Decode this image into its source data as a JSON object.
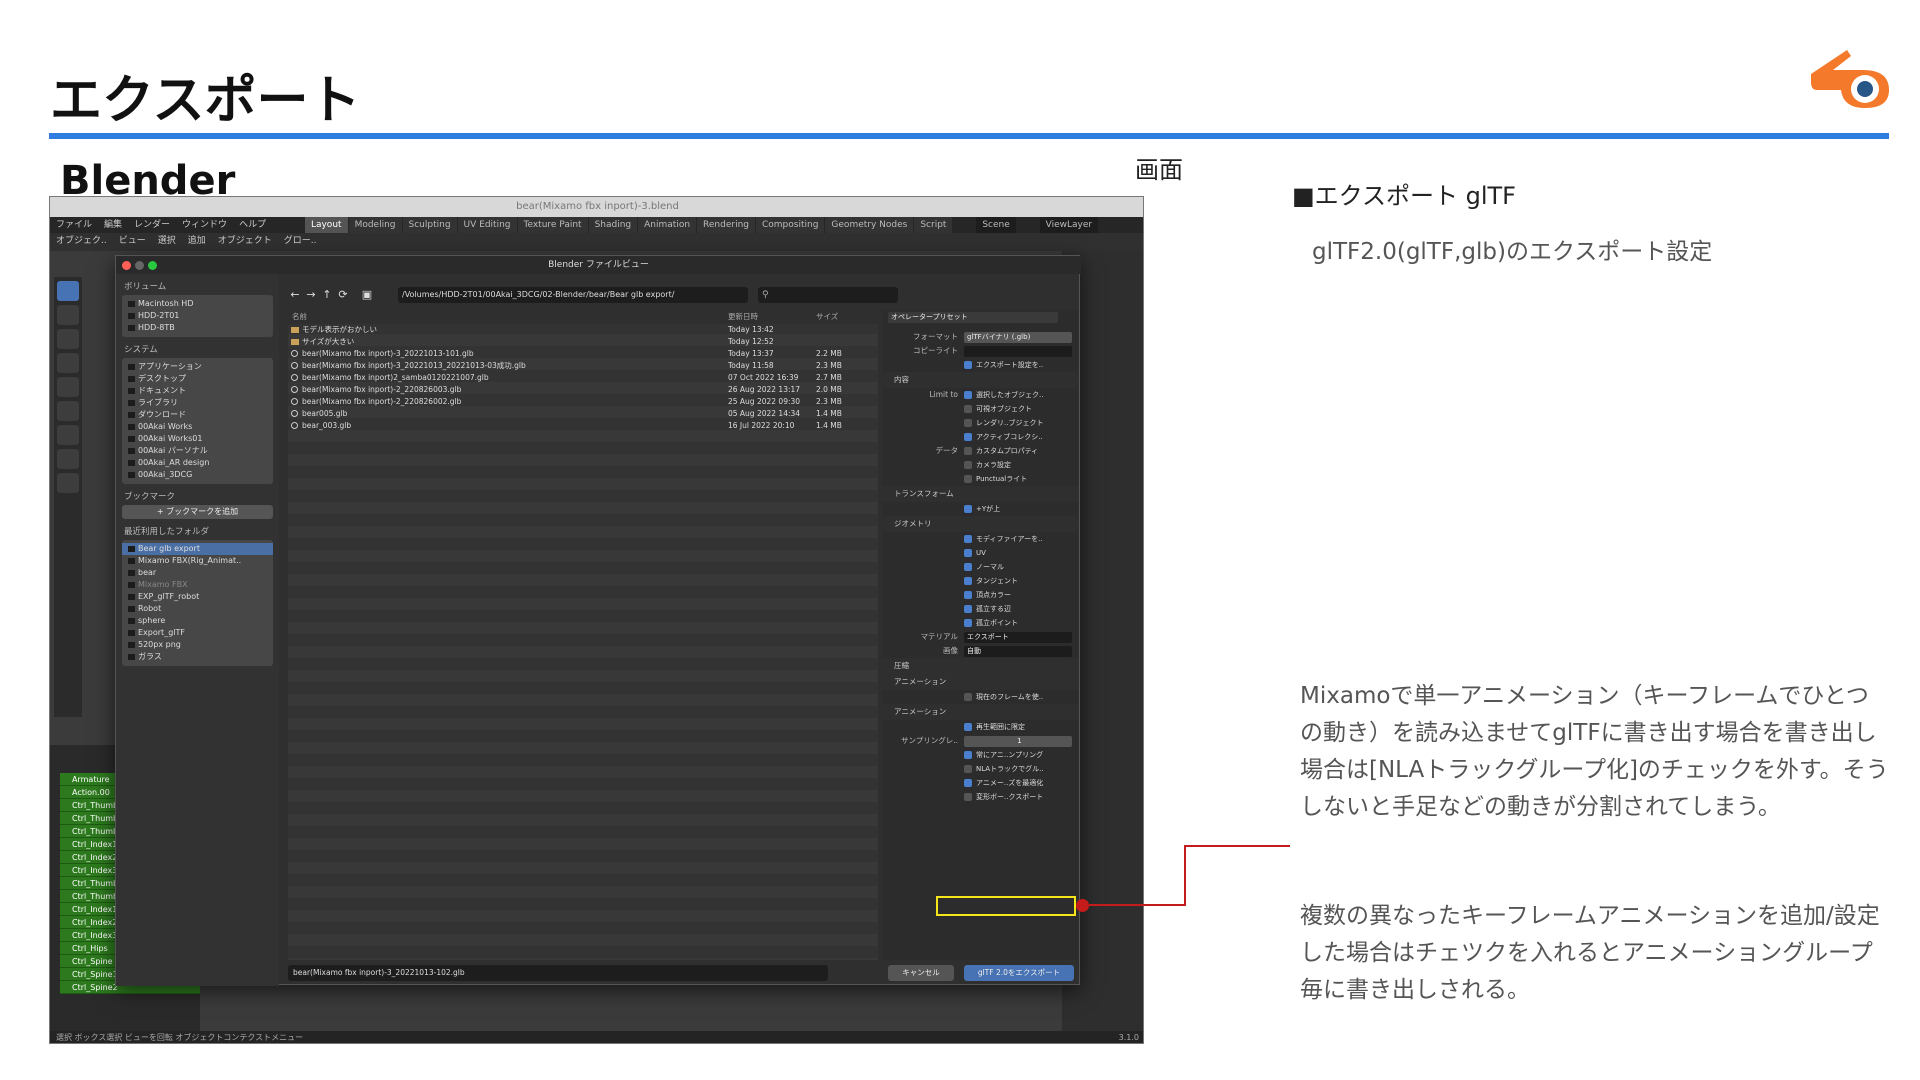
{
  "slide": {
    "title": "エクスポート",
    "app_label": "Blender",
    "screen_label": "画面",
    "export_heading": "■エクスポート glTF",
    "export_sub": "glTF2.0(glTF,glb)のエクスポート設定",
    "note1": "Mixamoで単一アニメーション（キーフレームでひとつの動き）を読み込ませてglTFに書き出す場合を書き出し場合は[NLAトラックグループ化]のチェックを外す。そうしないと手足などの動きが分割されてしまう。",
    "note2": "複数の異なったキーフレームアニメーションを追加/設定した場合はチェツクを入れるとアニメーショングループ毎に書き出しされる。",
    "logo_icon": "blender-logo-icon",
    "accent_color": "#2f7de1"
  },
  "window": {
    "title": "bear(Mixamo fbx inport)-3.blend",
    "menu": [
      "ファイル",
      "編集",
      "レンダー",
      "ウィンドウ",
      "ヘルプ"
    ],
    "workspaces": [
      "Layout",
      "Modeling",
      "Sculpting",
      "UV Editing",
      "Texture Paint",
      "Shading",
      "Animation",
      "Rendering",
      "Compositing",
      "Geometry Nodes",
      "Script"
    ],
    "scene": "Scene",
    "view_layer": "ViewLayer",
    "header2": [
      "オブジェク..",
      "ビュー",
      "選択",
      "追加",
      "オブジェクト",
      "グロー.."
    ],
    "status": "選択      ボックス選択                ビューを回転                          オブジェクトコンテクストメニュー",
    "version": "3.1.0"
  },
  "outliner": {
    "items": [
      "Armature",
      "Action.00",
      "Ctrl_Thumb",
      "Ctrl_Thumb",
      "Ctrl_Thumb",
      "Ctrl_Index1",
      "Ctrl_Index2",
      "Ctrl_Index3",
      "Ctrl_Thumb",
      "Ctrl_Thumb",
      "Ctrl_Index1",
      "Ctrl_Index2",
      "Ctrl_Index3",
      "Ctrl_Hips",
      "Ctrl_Spine",
      "Ctrl_Spine1",
      "Ctrl_Spine2"
    ]
  },
  "filebrowser": {
    "title": "Blender ファイルビュー",
    "path": "/Volumes/HDD-2T01/00Akai_3DCG/02-Blender/bear/Bear glb export/",
    "sections": {
      "volumes": "ボリューム",
      "system": "システム",
      "bookmarks": "ブックマーク",
      "recent": "最近利用したフォルダ"
    },
    "volumes": [
      "Macintosh HD",
      "HDD-2T01",
      "HDD-8TB"
    ],
    "system": [
      "アプリケーション",
      "デスクトップ",
      "ドキュメント",
      "ライブラリ",
      "ダウンロード",
      "00Akai Works",
      "00Akai Works01",
      "00Akai パーソナル",
      "00Akai_AR design",
      "00Akai_3DCG"
    ],
    "add_bookmark": "ブックマークを追加",
    "recent": [
      "Bear glb export",
      "Mixamo FBX(Rig_Animat..",
      "bear",
      "Mixamo FBX",
      "EXP_glTF_robot",
      "Robot",
      "sphere",
      "Export_glTF",
      "520px png",
      "ガラス"
    ],
    "columns": {
      "name": "名前",
      "date": "更新日時",
      "size": "サイズ"
    },
    "files": [
      {
        "name": "モデル表示がおかしい",
        "date": "Today 13:42",
        "size": "",
        "type": "folder"
      },
      {
        "name": "サイズが大きい",
        "date": "Today 12:52",
        "size": "",
        "type": "folder"
      },
      {
        "name": "bear(Mixamo fbx inport)-3_20221013-101.glb",
        "date": "Today 13:37",
        "size": "2.2 MB",
        "type": "glb"
      },
      {
        "name": "bear(Mixamo fbx inport)-3_20221013_20221013-03成功.glb",
        "date": "Today 11:58",
        "size": "2.3 MB",
        "type": "glb"
      },
      {
        "name": "bear(Mixamo fbx inport)2_samba0120221007.glb",
        "date": "07 Oct 2022 16:39",
        "size": "2.7 MB",
        "type": "glb"
      },
      {
        "name": "bear(Mixamo fbx inport)-2_220826003.glb",
        "date": "26 Aug 2022 13:17",
        "size": "2.0 MB",
        "type": "glb"
      },
      {
        "name": "bear(Mixamo fbx inport)-2_220826002.glb",
        "date": "25 Aug 2022 09:30",
        "size": "2.3 MB",
        "type": "glb"
      },
      {
        "name": "bear005.glb",
        "date": "05 Aug 2022 14:34",
        "size": "1.4 MB",
        "type": "glb"
      },
      {
        "name": "bear_003.glb",
        "date": "16 Jul 2022 20:10",
        "size": "1.4 MB",
        "type": "glb"
      }
    ],
    "filename": "bear(Mixamo fbx inport)-3_20221013-102.glb",
    "cancel": "キャンセル",
    "export": "glTF 2.0をエクスポート",
    "operator_preset": "オペレータープリセット",
    "format_label": "フォーマット",
    "format_value": "glTFバイナリ (.glb)",
    "copyright_label": "コピーライト",
    "remember": "エクスポート設定を..",
    "content": "内容",
    "limit_to": "Limit to",
    "limit_items": [
      {
        "label": "選択したオブジェク..",
        "on": true
      },
      {
        "label": "可視オブジェクト",
        "on": false
      },
      {
        "label": "レンダリ..ブジェクト",
        "on": false
      },
      {
        "label": "アクティブコレクシ..",
        "on": true
      }
    ],
    "data_label": "データ",
    "data_items": [
      {
        "label": "カスタムプロパティ",
        "on": false
      },
      {
        "label": "カメラ設定",
        "on": false
      },
      {
        "label": "Punctualライト",
        "on": false
      }
    ],
    "transform": "トランスフォーム",
    "yup": "+Yが上",
    "geometry": "ジオメトリ",
    "geo_items": [
      {
        "label": "モディファイアーを..",
        "on": true
      },
      {
        "label": "UV",
        "on": true
      },
      {
        "label": "ノーマル",
        "on": true
      },
      {
        "label": "タンジェント",
        "on": true
      },
      {
        "label": "頂点カラー",
        "on": true
      },
      {
        "label": "孤立する辺",
        "on": true
      },
      {
        "label": "孤立ポイント",
        "on": true
      }
    ],
    "material_label": "マテリアル",
    "material_value": "エクスポート",
    "image_label": "画像",
    "image_value": "自動",
    "compress": "圧縮",
    "animation_sec": "アニメーション",
    "use_current_frame": "現在のフレームを使..",
    "animation_sub": "アニメーション",
    "anim_items": [
      {
        "label": "再生範囲に限定",
        "on": true
      }
    ],
    "sampling_label": "サンプリングレ..",
    "sampling_value": "1",
    "anim_items2": [
      {
        "label": "常にアニ..ンプリング",
        "on": true
      },
      {
        "label": "NLAトラックでグル..",
        "on": false
      },
      {
        "label": "アニメー..ズを最適化",
        "on": true
      },
      {
        "label": "変形ボー..クスポート",
        "on": false
      }
    ]
  }
}
